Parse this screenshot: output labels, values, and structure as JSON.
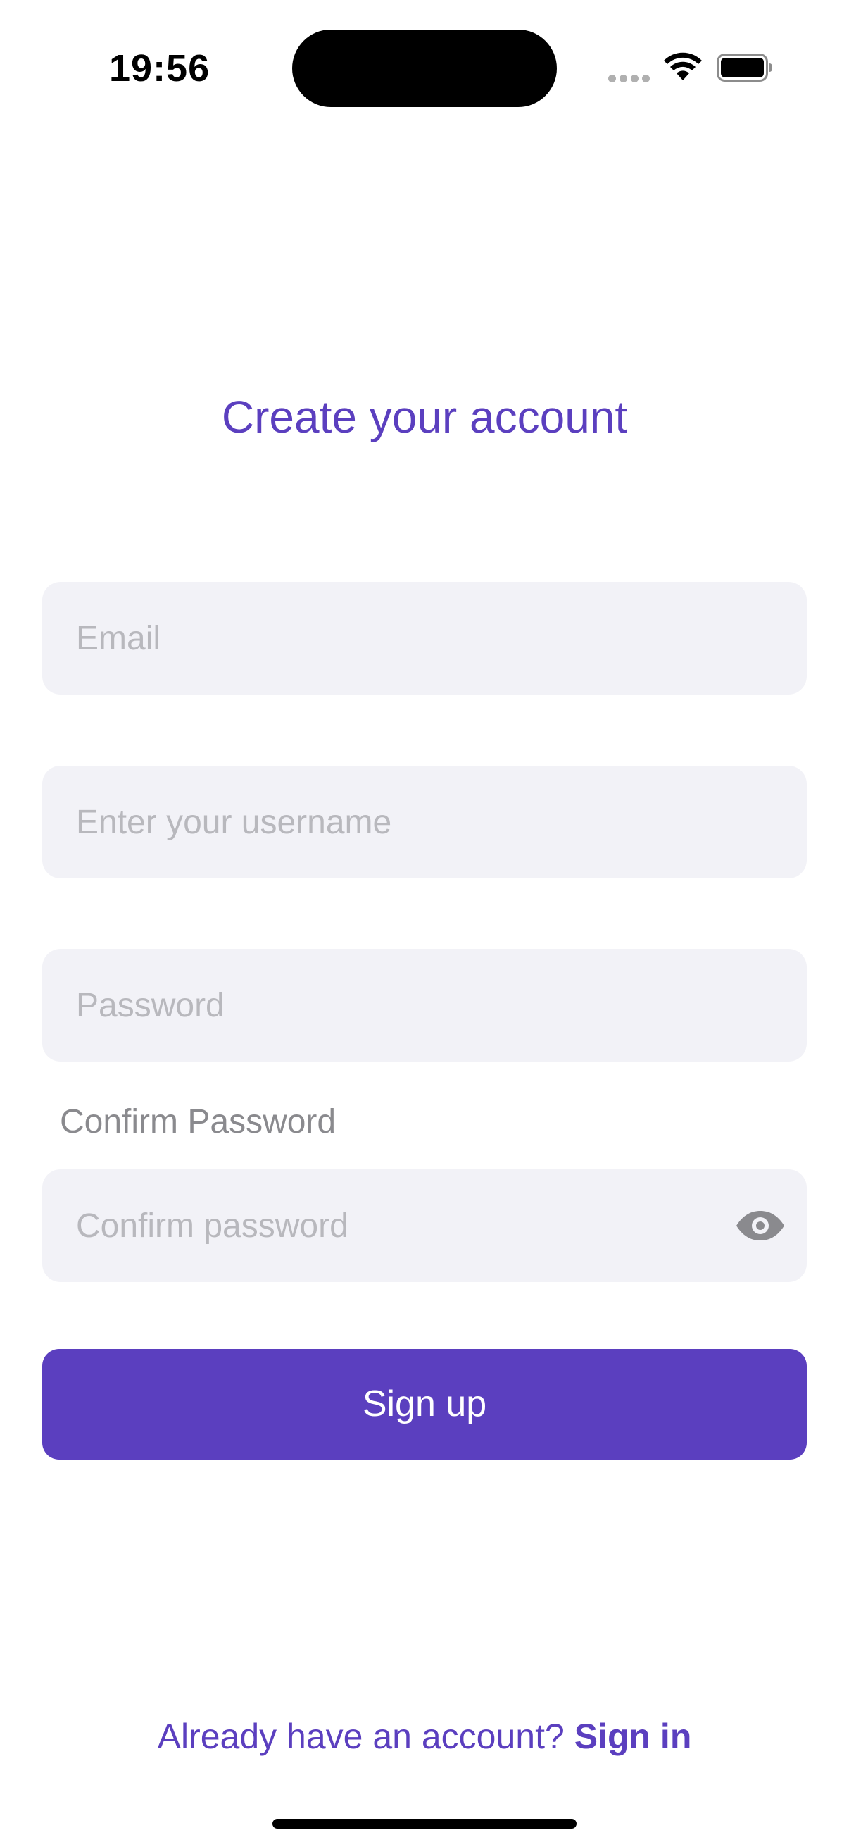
{
  "status_bar": {
    "time": "19:56"
  },
  "title": "Create your account",
  "form": {
    "email": {
      "value": "",
      "placeholder": "Email"
    },
    "username": {
      "value": "",
      "placeholder": "Enter your username"
    },
    "password": {
      "value": "",
      "placeholder": "Password"
    },
    "confirm": {
      "label": "Confirm Password",
      "value": "",
      "placeholder": "Confirm password"
    },
    "visibility_icon": "eye-icon"
  },
  "signup_button": "Sign up",
  "footer": {
    "prompt": "Already have an account?",
    "link": "Sign in"
  },
  "colors": {
    "accent": "#5b3fbf",
    "field_background": "#f2f2f7",
    "placeholder": "#b8b8bd"
  }
}
